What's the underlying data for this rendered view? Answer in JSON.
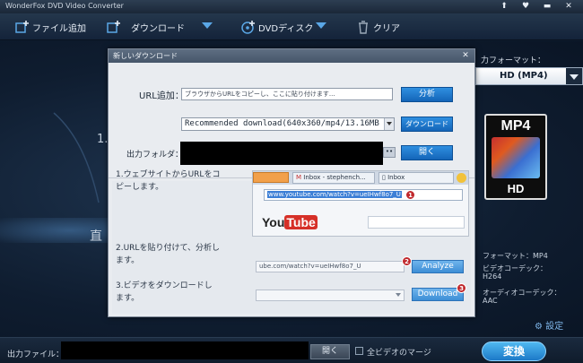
{
  "app": {
    "title": "WonderFox DVD Video Converter",
    "window_controls": [
      "⬆",
      "♥",
      "▬",
      "✕"
    ]
  },
  "toolbar": {
    "add_file": "ファイル追加",
    "download": "ダウンロード",
    "dvd_disc": "DVDディスク",
    "clear": "クリア"
  },
  "background": {
    "step_hint": "1.",
    "drag_hint": "直"
  },
  "right_panel": {
    "output_format_label": "力フォーマット：",
    "format_value": "HD (MP4)",
    "icon_top": "MP4",
    "icon_bottom": "HD",
    "format_info": "フォーマット：MP4",
    "video_codec_label": "ビデオコーデック：",
    "video_codec_value": "H264",
    "audio_codec_label": "オーディオコーデック：",
    "audio_codec_value": "AAC",
    "settings": "設定"
  },
  "bottom": {
    "output_file_label": "出力ファイル：",
    "open_button": "開く",
    "merge_label": "全ビデオのマージ",
    "convert_button": "変換"
  },
  "dialog": {
    "title": "新しいダウンロード",
    "close": "✕",
    "url_label": "URL追加：",
    "url_placeholder": "ブラウザからURLをコピーし、ここに貼り付けます...",
    "analyze_button": "分析",
    "download_option": "Recommended download(640x360/mp4/13.16MB",
    "download_button": "ダウンロード",
    "output_folder_label": "出力フォルダ：",
    "browse_button": "••",
    "open_button": "開く",
    "step1_line1": "1.ウェブサイトからURLをコ",
    "step1_line2": "ピーします。",
    "step2_line1": "2.URLを貼り付けて、分析し",
    "step2_line2": "ます。",
    "step3_line1": "3.ビデオをダウンロードし",
    "step3_line2": "ます。",
    "mock_tab1": "Inbox - stephench...",
    "mock_tab2": "Inbox",
    "mock_url": "www.youtube.com/watch?v=ueIHwf8o7_U",
    "mock_logo_you": "You",
    "mock_logo_tube": "Tube",
    "mock_badge1": "1",
    "mock_field2": "ube.com/watch?v=ueIHwf8o7_U",
    "mock_analyze": "Analyze",
    "mock_badge2": "2",
    "mock_download": "Download",
    "mock_badge3": "3"
  }
}
